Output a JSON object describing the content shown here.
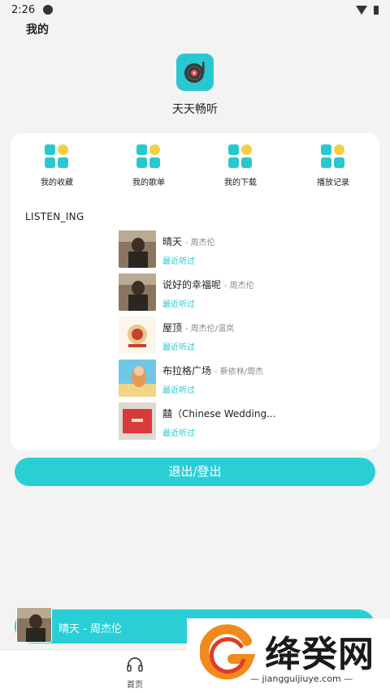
{
  "status": {
    "time": "2:26"
  },
  "page": {
    "title": "我的",
    "app_name": "天天畅听"
  },
  "quick_actions": [
    {
      "label": "我的收藏"
    },
    {
      "label": "我的歌单"
    },
    {
      "label": "我的下载"
    },
    {
      "label": "播放记录"
    }
  ],
  "section": {
    "title": "LISTEN_ING"
  },
  "songs": [
    {
      "title": "晴天",
      "artist": "- 周杰伦",
      "tag": "最近听过"
    },
    {
      "title": "说好的幸福呢",
      "artist": "- 周杰伦",
      "tag": "最近听过"
    },
    {
      "title": "屋顶",
      "artist": "- 周杰伦/温岚",
      "tag": "最近听过"
    },
    {
      "title": "布拉格广场",
      "artist": "- 蔡依林/周杰",
      "tag": "最近听过"
    },
    {
      "title": "囍（Chinese Wedding...",
      "artist": "",
      "tag": "最近听过"
    }
  ],
  "logout": {
    "label": "退出/登出"
  },
  "mini_player": {
    "title": "晴天 - 周杰伦"
  },
  "tabbar": {
    "home_label": "首页"
  },
  "watermark": {
    "title": "绛癸网",
    "subtitle": "— jiangguijiuye.com —"
  },
  "colors": {
    "accent": "#2acfd6",
    "accent_yellow": "#f4cf3f"
  },
  "icons": {
    "app_logo": "turntable-icon",
    "quick_action": "grid-icon",
    "tab_home": "headphones-icon"
  }
}
